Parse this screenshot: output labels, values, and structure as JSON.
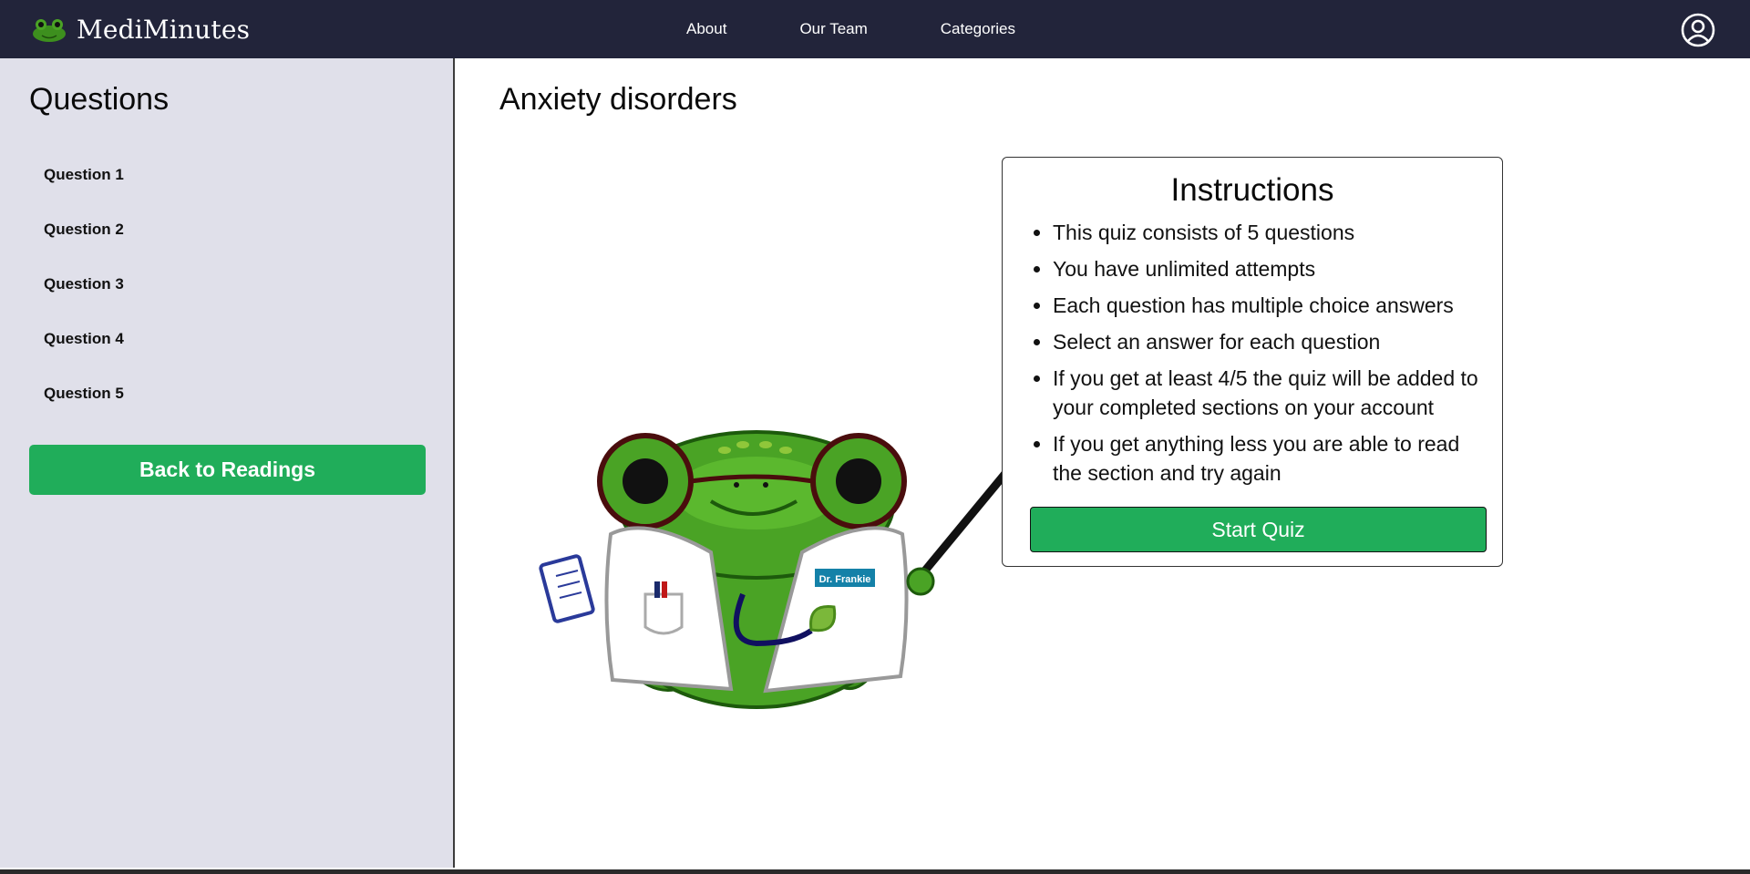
{
  "brand": {
    "name": "MediMinutes",
    "logo_icon": "frog-logo-icon"
  },
  "nav": {
    "links": [
      "About",
      "Our Team",
      "Categories"
    ],
    "profile_icon": "user-circle-icon"
  },
  "sidebar": {
    "title": "Questions",
    "questions": [
      "Question 1",
      "Question 2",
      "Question 3",
      "Question 4",
      "Question 5"
    ],
    "back_button": "Back to Readings"
  },
  "main": {
    "title": "Anxiety disorders"
  },
  "instructions": {
    "title": "Instructions",
    "items": [
      "This quiz consists of 5 questions",
      "You have unlimited attempts",
      "Each question has multiple choice answers",
      "Select an answer for each question",
      "If you get at least 4/5 the quiz will be added to your completed sections on your account",
      "If you get anything less you are able to read the section and try again"
    ],
    "start_button": "Start Quiz"
  },
  "mascot": {
    "badge_text": "Dr. Frankie",
    "icon": "frog-doctor-illustration"
  },
  "colors": {
    "navbar": "#22243a",
    "sidebar": "#e0e0ea",
    "accent_green": "#20ad5a"
  }
}
